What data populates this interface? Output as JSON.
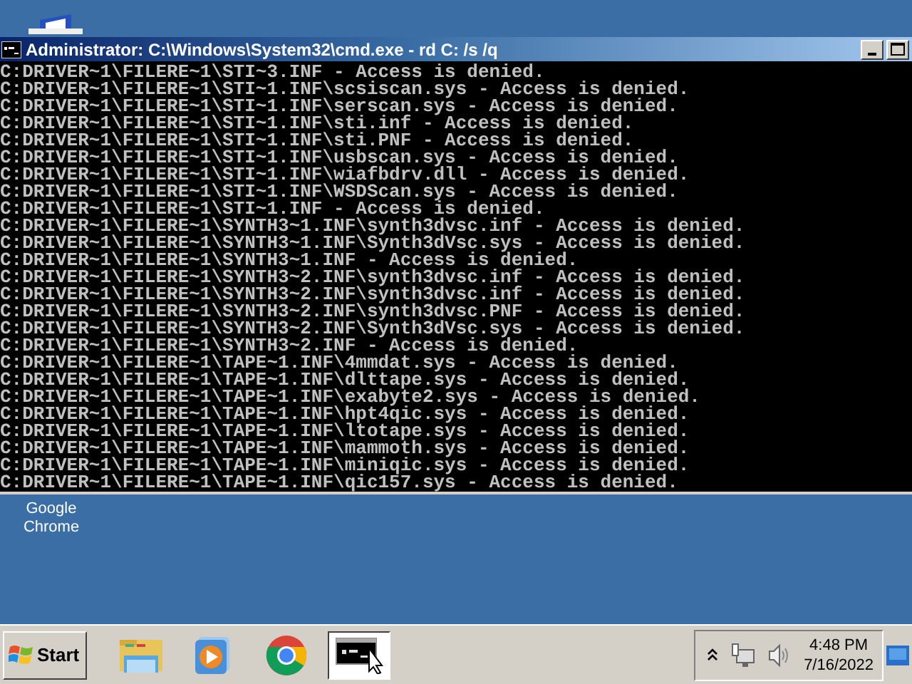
{
  "window": {
    "title": "Administrator: C:\\Windows\\System32\\cmd.exe - rd  C: /s /q",
    "lines": [
      "C:DRIVER~1\\FILERE~1\\STI~3.INF - Access is denied.",
      "C:DRIVER~1\\FILERE~1\\STI~1.INF\\scsiscan.sys - Access is denied.",
      "C:DRIVER~1\\FILERE~1\\STI~1.INF\\serscan.sys - Access is denied.",
      "C:DRIVER~1\\FILERE~1\\STI~1.INF\\sti.inf - Access is denied.",
      "C:DRIVER~1\\FILERE~1\\STI~1.INF\\sti.PNF - Access is denied.",
      "C:DRIVER~1\\FILERE~1\\STI~1.INF\\usbscan.sys - Access is denied.",
      "C:DRIVER~1\\FILERE~1\\STI~1.INF\\wiafbdrv.dll - Access is denied.",
      "C:DRIVER~1\\FILERE~1\\STI~1.INF\\WSDScan.sys - Access is denied.",
      "C:DRIVER~1\\FILERE~1\\STI~1.INF - Access is denied.",
      "C:DRIVER~1\\FILERE~1\\SYNTH3~1.INF\\synth3dvsc.inf - Access is denied.",
      "C:DRIVER~1\\FILERE~1\\SYNTH3~1.INF\\Synth3dVsc.sys - Access is denied.",
      "C:DRIVER~1\\FILERE~1\\SYNTH3~1.INF - Access is denied.",
      "C:DRIVER~1\\FILERE~1\\SYNTH3~2.INF\\synth3dvsc.inf - Access is denied.",
      "C:DRIVER~1\\FILERE~1\\SYNTH3~2.INF\\synth3dvsc.inf - Access is denied.",
      "C:DRIVER~1\\FILERE~1\\SYNTH3~2.INF\\synth3dvsc.PNF - Access is denied.",
      "C:DRIVER~1\\FILERE~1\\SYNTH3~2.INF\\Synth3dVsc.sys - Access is denied.",
      "C:DRIVER~1\\FILERE~1\\SYNTH3~2.INF - Access is denied.",
      "C:DRIVER~1\\FILERE~1\\TAPE~1.INF\\4mmdat.sys - Access is denied.",
      "C:DRIVER~1\\FILERE~1\\TAPE~1.INF\\dlttape.sys - Access is denied.",
      "C:DRIVER~1\\FILERE~1\\TAPE~1.INF\\exabyte2.sys - Access is denied.",
      "C:DRIVER~1\\FILERE~1\\TAPE~1.INF\\hpt4qic.sys - Access is denied.",
      "C:DRIVER~1\\FILERE~1\\TAPE~1.INF\\ltotape.sys - Access is denied.",
      "C:DRIVER~1\\FILERE~1\\TAPE~1.INF\\mammoth.sys - Access is denied.",
      "C:DRIVER~1\\FILERE~1\\TAPE~1.INF\\miniqic.sys - Access is denied.",
      "C:DRIVER~1\\FILERE~1\\TAPE~1.INF\\qic157.sys - Access is denied."
    ]
  },
  "desktop_icons": [
    {
      "label": "Google Chrome"
    }
  ],
  "taskbar": {
    "start": "Start",
    "apps": [
      {
        "kind": "folder",
        "selected": false
      },
      {
        "kind": "player",
        "selected": false
      },
      {
        "kind": "browser",
        "selected": false
      },
      {
        "kind": "console",
        "selected": true
      }
    ],
    "time": "4:48 PM",
    "date": "7/16/2022"
  }
}
